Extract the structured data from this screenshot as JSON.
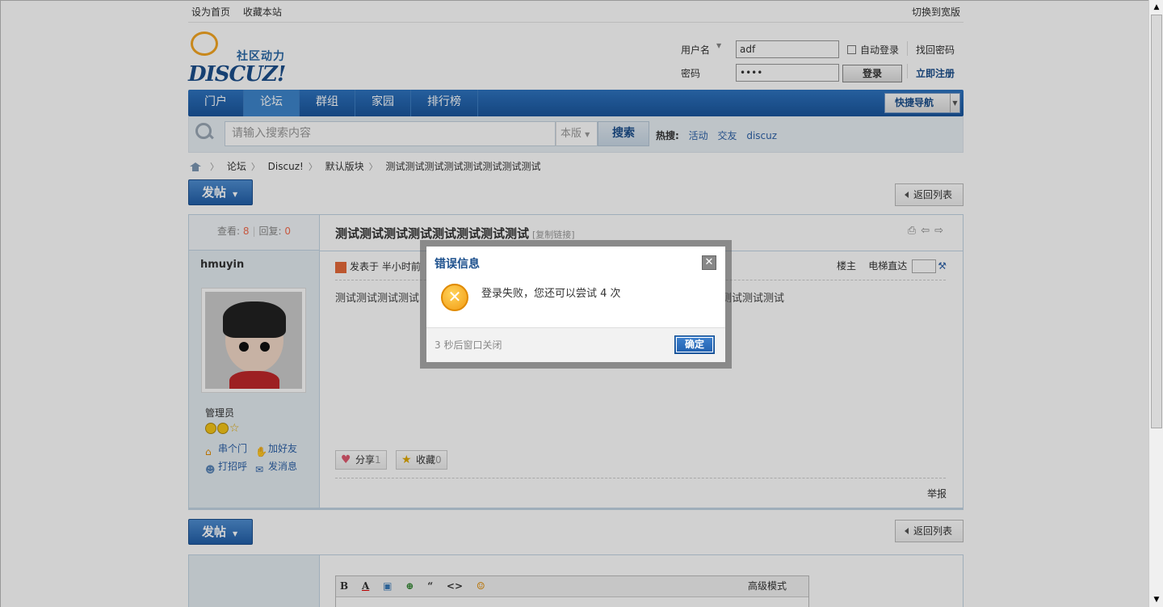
{
  "topbar": {
    "set_home": "设为首页",
    "bookmark": "收藏本站",
    "wide": "切换到宽版"
  },
  "logo": {
    "tagline": "社区动力",
    "brand": "DISCUZ!"
  },
  "login": {
    "username_label": "用户名",
    "username_value": "adf",
    "password_label": "密码",
    "password_value": "••••",
    "auto_login": "自动登录",
    "find_password": "找回密码",
    "login_button": "登录",
    "register": "立即注册"
  },
  "nav": {
    "items": [
      {
        "label": "门户"
      },
      {
        "label": "论坛"
      },
      {
        "label": "群组"
      },
      {
        "label": "家园"
      },
      {
        "label": "排行榜"
      }
    ],
    "active_index": 1,
    "quick_nav": "快捷导航"
  },
  "search": {
    "placeholder": "请输入搜索内容",
    "scope": "本版",
    "button": "搜索",
    "hot_label": "热搜:",
    "hot": [
      "活动",
      "交友",
      "discuz"
    ]
  },
  "breadcrumb": [
    "论坛",
    "Discuz!",
    "默认版块",
    "测试测试测试测试测试测试测试测试"
  ],
  "buttons": {
    "post": "发帖",
    "back": "返回列表"
  },
  "post": {
    "views_label": "查看:",
    "views": "8",
    "replies_label": "回复:",
    "replies": "0",
    "title": "测试测试测试测试测试测试测试测试",
    "copy_link": "[复制链接]",
    "author": "hmuyin",
    "role": "管理员",
    "user_links": [
      "串个门",
      "加好友",
      "打招呼",
      "发消息"
    ],
    "posted": "发表于 半小时前",
    "floor_label": "楼主",
    "elevator": "电梯直达",
    "content_left": "测试测试测试测试",
    "content_right": "测试测试测试",
    "share": "分享",
    "share_count": "1",
    "favorite": "收藏",
    "favorite_count": "0",
    "report": "举报"
  },
  "reply": {
    "tools": [
      "B",
      "A",
      "▣",
      "⊕",
      "“",
      "<>",
      "☺"
    ],
    "advanced": "高级模式"
  },
  "dialog": {
    "title": "错误信息",
    "message": "登录失败，您还可以尝试 4 次",
    "timer": "3 秒后窗口关闭",
    "ok": "确定"
  }
}
